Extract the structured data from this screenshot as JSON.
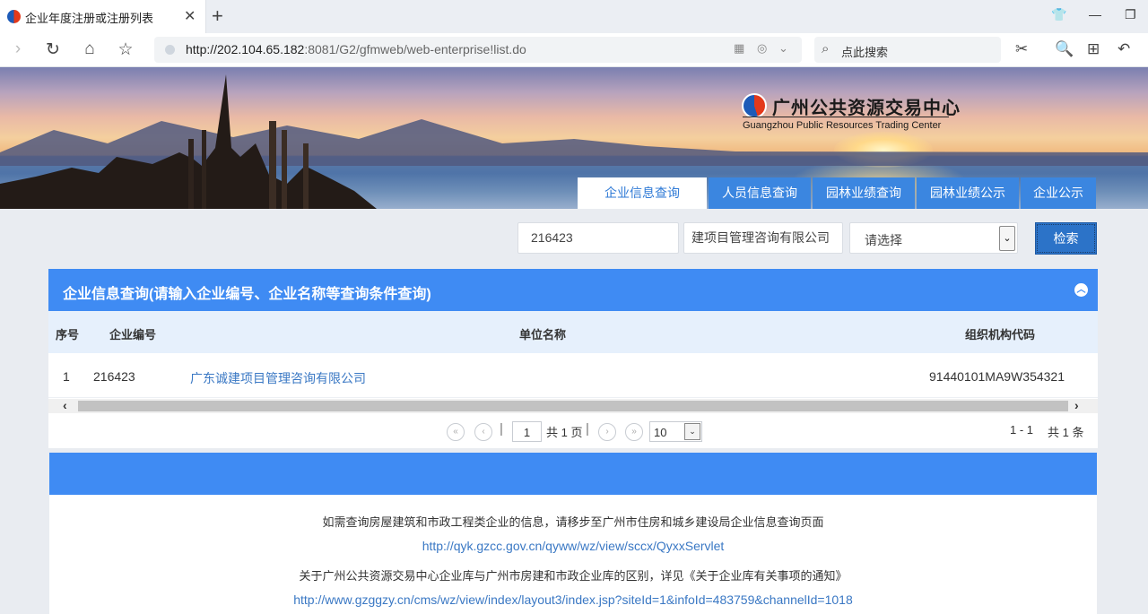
{
  "browser": {
    "tab_title": "企业年度注册或注册列表",
    "url_host": "http://202.104.65.182",
    "url_rest": ":8081/G2/gfmweb/web-enterprise!list.do",
    "search_placeholder": "点此搜索"
  },
  "site": {
    "logo_cn": "广州公共资源交易中心",
    "logo_en": "Guangzhou Public Resources Trading Center",
    "nav": [
      "企业信息查询",
      "人员信息查询",
      "园林业绩查询",
      "园林业绩公示",
      "企业公示"
    ]
  },
  "search": {
    "code_value": "216423",
    "name_value": "建项目管理咨询有限公司",
    "select_value": "请选择",
    "button_label": "检索"
  },
  "panel": {
    "title": "企业信息查询(请输入企业编号、企业名称等查询条件查询)",
    "columns": [
      "序号",
      "企业编号",
      "单位名称",
      "组织机构代码"
    ],
    "rows": [
      {
        "index": "1",
        "code": "216423",
        "name": "广东诚建项目管理咨询有限公司",
        "org_code": "91440101MA9W354321"
      }
    ]
  },
  "pager": {
    "page": "1",
    "total_pages_text": "共 1 页",
    "page_size": "10",
    "range_text": "1 - 1",
    "total_text": "共 1 条"
  },
  "notice": {
    "line1": "如需查询房屋建筑和市政工程类企业的信息，请移步至广州市住房和城乡建设局企业信息查询页面",
    "link1": "http://qyk.gzcc.gov.cn/qyww/wz/view/sccx/QyxxServlet",
    "line2": "关于广州公共资源交易中心企业库与广州市房建和市政企业库的区别，详见《关于企业库有关事项的通知》",
    "link2": "http://www.gzggzy.cn/cms/wz/view/index/layout3/index.jsp?siteId=1&infoId=483759&channelId=1018"
  }
}
